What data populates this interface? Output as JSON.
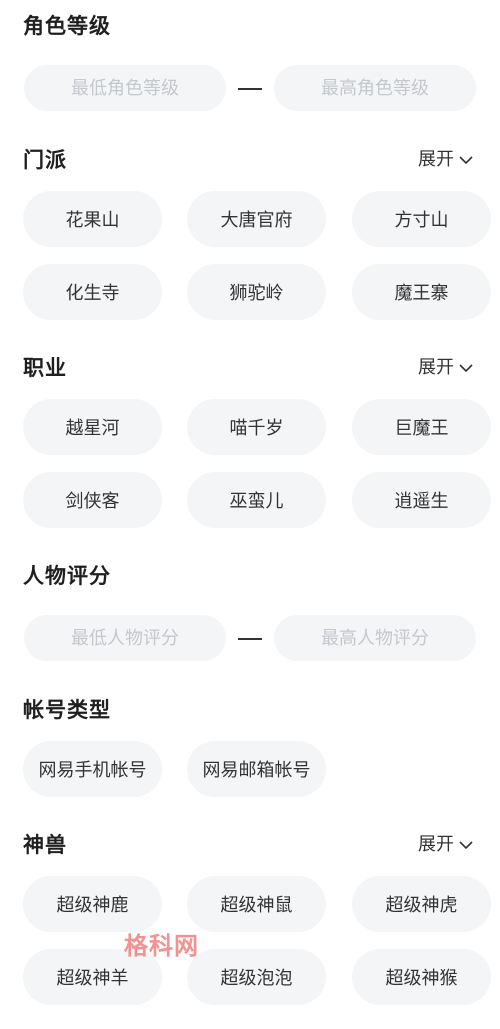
{
  "role_level": {
    "title": "角色等级",
    "min_placeholder": "最低角色等级",
    "max_placeholder": "最高角色等级"
  },
  "sect": {
    "title": "门派",
    "expand_label": "展开",
    "options": [
      "花果山",
      "大唐官府",
      "方寸山",
      "化生寺",
      "狮驼岭",
      "魔王寨"
    ]
  },
  "profession": {
    "title": "职业",
    "expand_label": "展开",
    "options": [
      "越星河",
      "喵千岁",
      "巨魔王",
      "剑侠客",
      "巫蛮儿",
      "逍遥生"
    ]
  },
  "character_score": {
    "title": "人物评分",
    "min_placeholder": "最低人物评分",
    "max_placeholder": "最高人物评分"
  },
  "account_type": {
    "title": "帐号类型",
    "options": [
      "网易手机帐号",
      "网易邮箱帐号"
    ]
  },
  "divine_beast": {
    "title": "神兽",
    "expand_label": "展开",
    "options": [
      "超级神鹿",
      "超级神鼠",
      "超级神虎",
      "超级神羊",
      "超级泡泡",
      "超级神猴"
    ]
  },
  "watermark": "格科网"
}
